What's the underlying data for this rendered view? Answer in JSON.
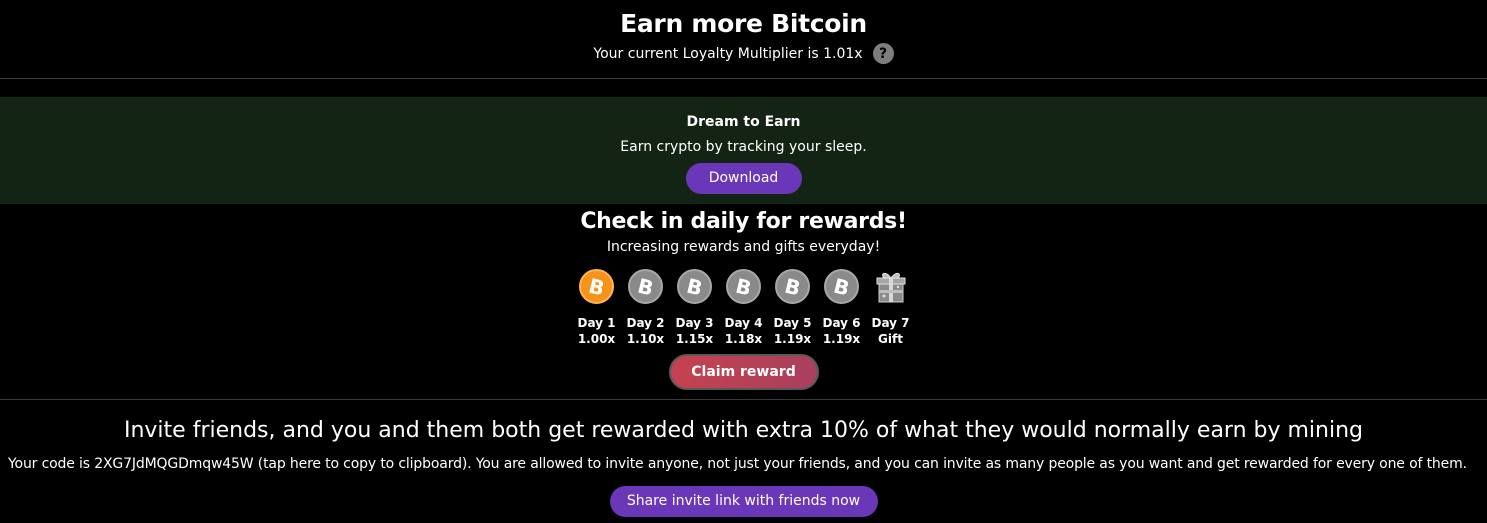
{
  "header": {
    "title": "Earn more Bitcoin",
    "multiplier_text": "Your current Loyalty Multiplier is 1.01x",
    "help_symbol": "?"
  },
  "promo": {
    "title": "Dream to Earn",
    "subtitle": "Earn crypto by tracking your sleep.",
    "button_label": "Download"
  },
  "daily": {
    "title": "Check in daily for rewards!",
    "subtitle": "Increasing rewards and gifts everyday!",
    "days": [
      {
        "label": "Day 1",
        "value": "1.00x",
        "icon": "bitcoin-icon",
        "active": true
      },
      {
        "label": "Day 2",
        "value": "1.10x",
        "icon": "bitcoin-icon",
        "active": false
      },
      {
        "label": "Day 3",
        "value": "1.15x",
        "icon": "bitcoin-icon",
        "active": false
      },
      {
        "label": "Day 4",
        "value": "1.18x",
        "icon": "bitcoin-icon",
        "active": false
      },
      {
        "label": "Day 5",
        "value": "1.19x",
        "icon": "bitcoin-icon",
        "active": false
      },
      {
        "label": "Day 6",
        "value": "1.19x",
        "icon": "bitcoin-icon",
        "active": false
      },
      {
        "label": "Day 7",
        "value": "Gift",
        "icon": "gift-icon",
        "active": false
      }
    ],
    "claim_label": "Claim reward"
  },
  "invite": {
    "title": "Invite friends, and you and them both get rewarded with extra 10% of what they would normally earn by mining",
    "description": "Your code is 2XG7JdMQGDmqw45W (tap here to copy to clipboard). You are allowed to invite anyone, not just your friends, and you can invite as many people as you want and get rewarded for every one of them.",
    "share_label": "Share invite link with friends now"
  },
  "colors": {
    "background": "#000000",
    "promo_background": "#142414",
    "accent_purple": "#6a37b8",
    "bitcoin_orange": "#f7931a",
    "inactive_coin": "#8a8a8a",
    "claim_red": "#c5424f"
  }
}
